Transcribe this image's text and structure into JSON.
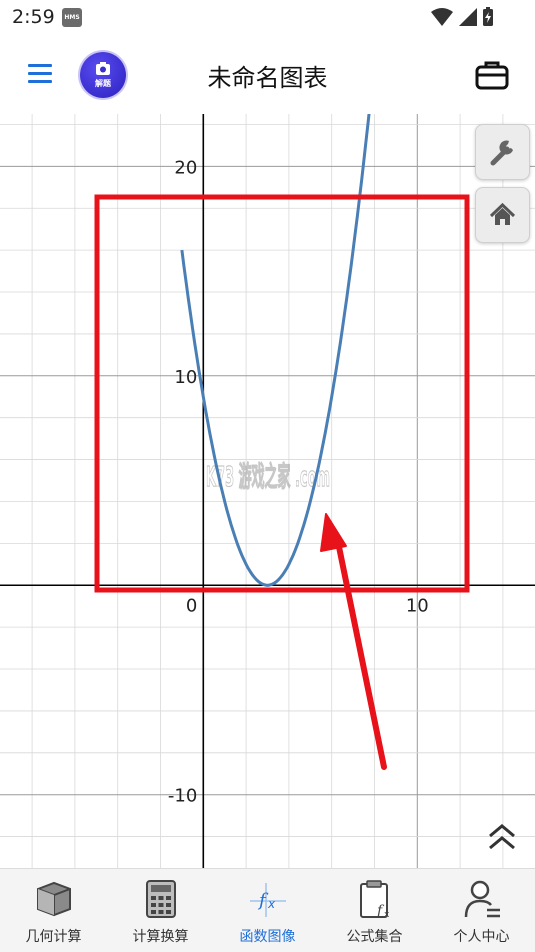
{
  "status_bar": {
    "time": "2:59",
    "hms_badge": "HMS"
  },
  "header": {
    "title": "未命名图表",
    "scan_label": "解题"
  },
  "graph": {
    "function": "y = (x - 3)^2",
    "axis_labels": {
      "x_0": "0",
      "x_10": "10",
      "y_10": "10",
      "y_20": "20",
      "y_neg10": "-10"
    },
    "watermark": "K73 游戏之家 .com",
    "colors": {
      "curve": "#4a7fb5",
      "highlight_box": "#e8121a",
      "arrow": "#e8121a"
    }
  },
  "chart_data": {
    "type": "line",
    "series": [
      {
        "x": [
          -1,
          0,
          1,
          2,
          3,
          4,
          5,
          6,
          7,
          8
        ],
        "y": [
          16,
          9,
          4,
          1,
          0,
          1,
          4,
          9,
          16,
          25
        ]
      }
    ],
    "xlim": [
      -9.5,
      15.5
    ],
    "ylim": [
      -13.5,
      22.5
    ],
    "x_ticks": [
      0,
      10
    ],
    "y_ticks": [
      -10,
      10,
      20
    ],
    "grid": true
  },
  "bottom_nav": {
    "items": [
      {
        "label": "几何计算",
        "icon": "cube-icon"
      },
      {
        "label": "计算换算",
        "icon": "calculator-icon"
      },
      {
        "label": "函数图像",
        "icon": "function-icon"
      },
      {
        "label": "公式集合",
        "icon": "clipboard-formula-icon"
      },
      {
        "label": "个人中心",
        "icon": "person-icon"
      }
    ],
    "active_index": 2
  }
}
